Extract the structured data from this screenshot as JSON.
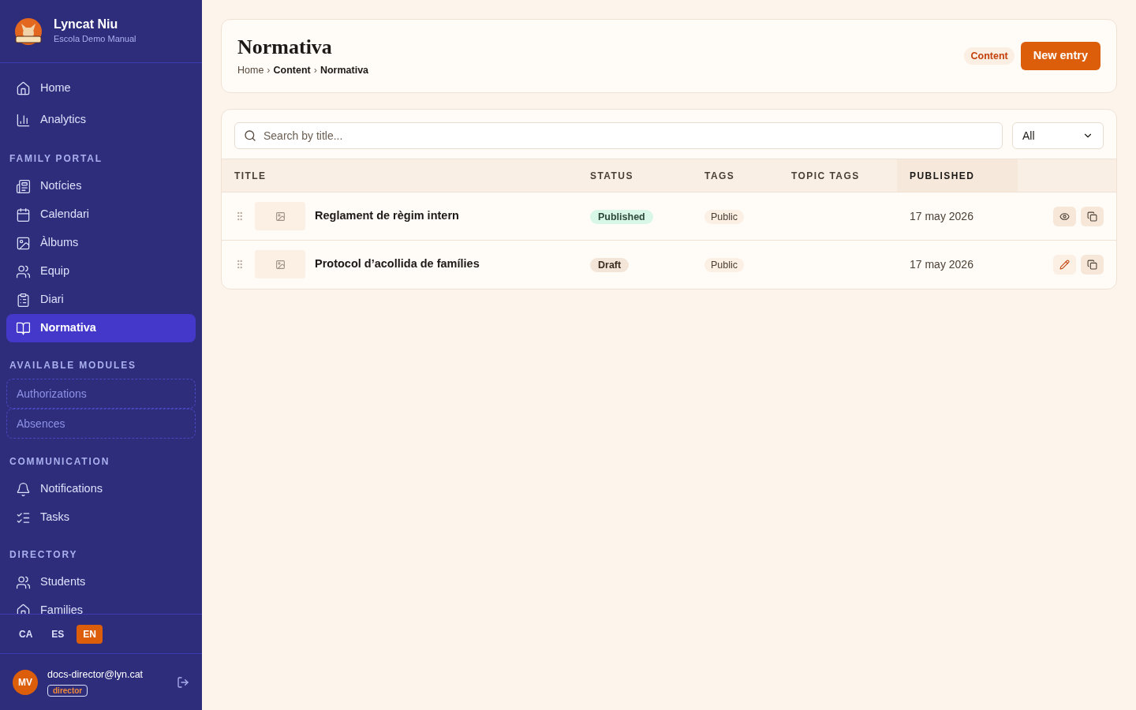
{
  "brand": {
    "name": "Lyncat Niu",
    "school": "Escola Demo Manual"
  },
  "nav_sections": [
    {
      "kind": "nav",
      "items": [
        {
          "label": "Home",
          "selected": false
        },
        {
          "label": "Analytics",
          "selected": false
        }
      ]
    },
    {
      "heading": "FAMILY PORTAL",
      "kind": "nav",
      "items": [
        {
          "label": "Notícies",
          "selected": false
        },
        {
          "label": "Calendari",
          "selected": false
        },
        {
          "label": "Àlbums",
          "selected": false
        },
        {
          "label": "Equip",
          "selected": false
        },
        {
          "label": "Diari",
          "selected": false
        },
        {
          "label": "Normativa",
          "selected": true
        }
      ]
    },
    {
      "heading": "AVAILABLE MODULES",
      "kind": "modules",
      "items": [
        {
          "label": "Authorizations",
          "selected": false
        },
        {
          "label": "Absences",
          "selected": false
        }
      ]
    },
    {
      "heading": "COMMUNICATION",
      "kind": "nav",
      "items": [
        {
          "label": "Notifications",
          "selected": false
        },
        {
          "label": "Tasks",
          "selected": false
        }
      ]
    },
    {
      "heading": "DIRECTORY",
      "kind": "nav",
      "items": [
        {
          "label": "Students",
          "selected": false
        },
        {
          "label": "Families",
          "selected": false
        }
      ]
    }
  ],
  "languages": [
    {
      "label": "CA",
      "selected": false
    },
    {
      "label": "ES",
      "selected": false
    },
    {
      "label": "EN",
      "selected": true
    }
  ],
  "user": {
    "initials": "MV",
    "email": "docs-director@lyn.cat",
    "role": "director"
  },
  "header": {
    "title": "Normativa",
    "breadcrumb": [
      "Home",
      "Content",
      "Normativa"
    ],
    "separator": "›",
    "badge": "Content",
    "button": "New entry"
  },
  "search": {
    "placeholder": "Search by title..."
  },
  "filter": {
    "value": "All"
  },
  "table": {
    "columns": [
      {
        "label": "TITLE",
        "selected": false
      },
      {
        "label": "STATUS",
        "selected": false
      },
      {
        "label": "TAGS",
        "selected": false
      },
      {
        "label": "TOPIC TAGS",
        "selected": false
      },
      {
        "label": "PUBLISHED",
        "selected": true
      }
    ],
    "rows": [
      {
        "title": "Reglament de règim intern",
        "status": {
          "label": "Published",
          "kind": "published"
        },
        "tags": [
          "Public"
        ],
        "published": "17 may 2026",
        "actions": [
          {
            "kind": "view"
          },
          {
            "kind": "copy"
          }
        ]
      },
      {
        "title": "Protocol d’acollida de famílies",
        "status": {
          "label": "Draft",
          "kind": "draft"
        },
        "tags": [
          "Public"
        ],
        "published": "17 may 2026",
        "actions": [
          {
            "kind": "edit"
          },
          {
            "kind": "copy"
          }
        ]
      }
    ]
  }
}
